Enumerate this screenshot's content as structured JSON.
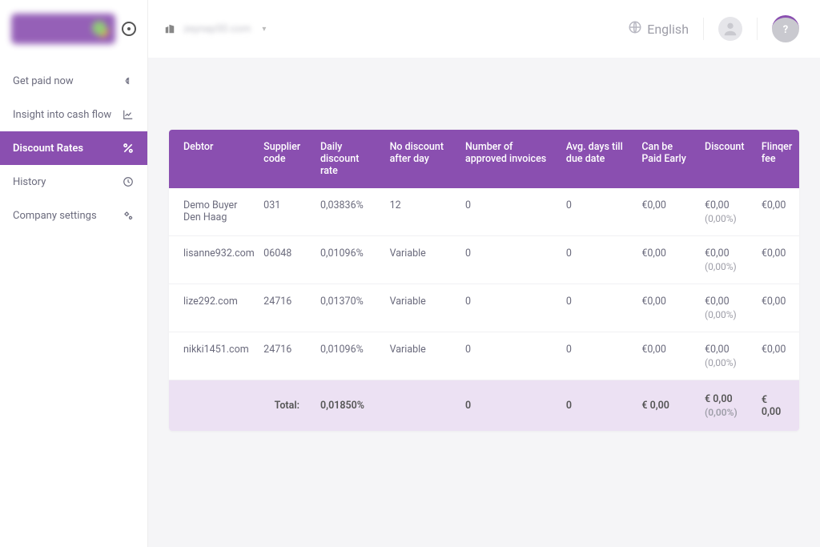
{
  "sidebar": {
    "items": [
      {
        "label": "Get paid now"
      },
      {
        "label": "Insight into cash flow"
      },
      {
        "label": "Discount Rates"
      },
      {
        "label": "History"
      },
      {
        "label": "Company settings"
      }
    ]
  },
  "topbar": {
    "company": "zeynep50.com",
    "language": "English",
    "help": "?"
  },
  "table": {
    "headers": {
      "debtor": "Debtor",
      "supplier_code": "Supplier code",
      "daily_rate": "Daily discount rate",
      "no_discount_after": "No discount after day",
      "approved": "Number of approved invoices",
      "avg_days": "Avg. days till due date",
      "paid_early": "Can be Paid Early",
      "discount": "Discount",
      "fee": "Flinqer fee"
    },
    "rows": [
      {
        "debtor": "Demo Buyer Den Haag",
        "supplier_code": "031",
        "daily_rate": "0,03836%",
        "no_discount_after": "12",
        "approved": "0",
        "avg_days": "0",
        "paid_early": "€0,00",
        "discount": "€0,00",
        "discount_sub": "(0,00%)",
        "fee": "€0,00"
      },
      {
        "debtor": "lisanne932.com",
        "supplier_code": "06048",
        "daily_rate": "0,01096%",
        "no_discount_after": "Variable",
        "approved": "0",
        "avg_days": "0",
        "paid_early": "€0,00",
        "discount": "€0,00",
        "discount_sub": "(0,00%)",
        "fee": "€0,00"
      },
      {
        "debtor": "lize292.com",
        "supplier_code": "24716",
        "daily_rate": "0,01370%",
        "no_discount_after": "Variable",
        "approved": "0",
        "avg_days": "0",
        "paid_early": "€0,00",
        "discount": "€0,00",
        "discount_sub": "(0,00%)",
        "fee": "€0,00"
      },
      {
        "debtor": "nikki1451.com",
        "supplier_code": "24716",
        "daily_rate": "0,01096%",
        "no_discount_after": "Variable",
        "approved": "0",
        "avg_days": "0",
        "paid_early": "€0,00",
        "discount": "€0,00",
        "discount_sub": "(0,00%)",
        "fee": "€0,00"
      }
    ],
    "total": {
      "label": "Total:",
      "daily_rate": "0,01850%",
      "approved": "0",
      "avg_days": "0",
      "paid_early": "€ 0,00",
      "discount": "€ 0,00",
      "discount_sub": "(0,00%)",
      "fee": "€ 0,00"
    }
  }
}
